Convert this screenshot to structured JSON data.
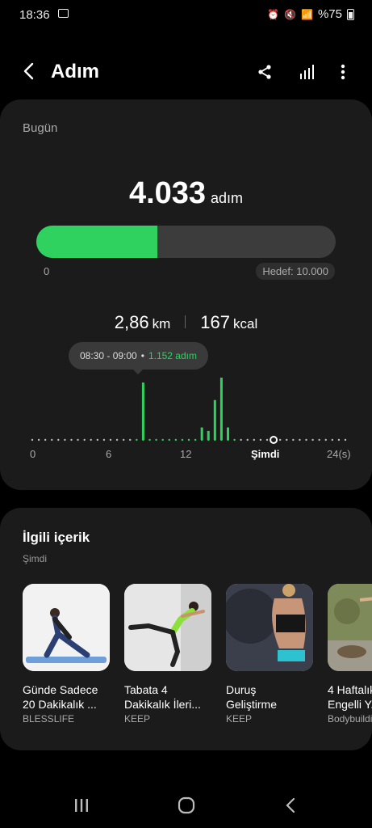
{
  "status": {
    "time": "18:36",
    "battery": "%75"
  },
  "appbar": {
    "title": "Adım"
  },
  "today": {
    "label": "Bugün",
    "steps": "4.033",
    "steps_unit": "adım",
    "progress": 0.4033,
    "zero": "0",
    "goal": "Hedef: 10.000",
    "distance": "2,86",
    "distance_unit": "km",
    "calories": "167",
    "calories_unit": "kcal",
    "tooltip_time": "08:30 - 09:00",
    "tooltip_sep": "•",
    "tooltip_steps": "1.152 adım"
  },
  "chart_data": {
    "type": "bar",
    "x_unit": "hour",
    "xlim": [
      0,
      24
    ],
    "x_ticks": [
      "0",
      "6",
      "12",
      "Şimdi",
      "24(s)"
    ],
    "now_hour": 18.5,
    "bars": [
      {
        "x": 8.5,
        "y": 1152
      },
      {
        "x": 13.0,
        "y": 250
      },
      {
        "x": 13.5,
        "y": 180
      },
      {
        "x": 14.0,
        "y": 800
      },
      {
        "x": 14.5,
        "y": 1250
      },
      {
        "x": 15.0,
        "y": 250
      }
    ],
    "color": "#2fd25e"
  },
  "related": {
    "title": "İlgili içerik",
    "subtitle": "Şimdi",
    "items": [
      {
        "title1": "Günde Sadece",
        "title2": "20 Dakikalık ...",
        "source": "BLESSLIFE"
      },
      {
        "title1": "Tabata 4",
        "title2": "Dakikalık İleri...",
        "source": "KEEP"
      },
      {
        "title1": "Duruş",
        "title2": "Geliştirme",
        "source": "KEEP"
      },
      {
        "title1": "4 Haftalık",
        "title2": "Engelli Y...",
        "source": "Bodybuilding"
      }
    ]
  }
}
